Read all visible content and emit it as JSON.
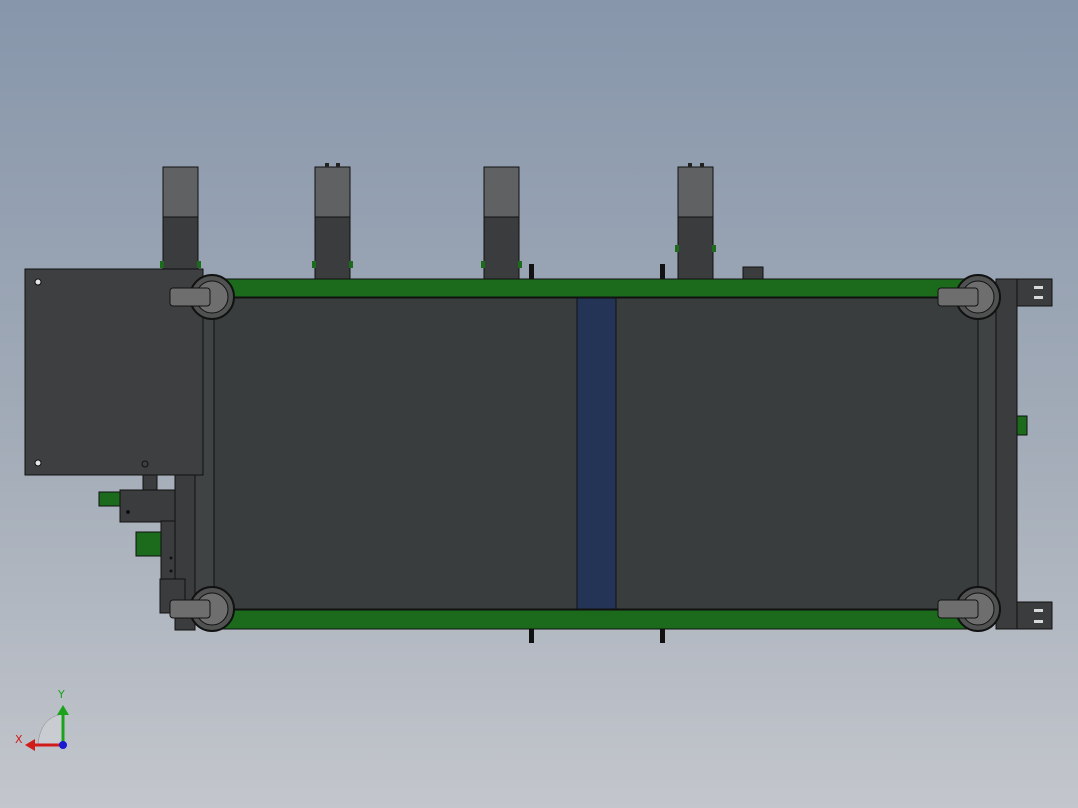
{
  "view": {
    "background_top": "#8796ab",
    "background_bottom": "#c3c6cc"
  },
  "model": {
    "frame_color": "#3a3d3d",
    "belt_rail_color": "#1c6b1c",
    "divider_color": "#233457",
    "panel_color": "#3d3f40",
    "sensor_top_color": "#5f6163",
    "caster_color": "#6e6e6e",
    "uprights_count": 4
  },
  "triad": {
    "x_label": "X",
    "y_label": "Y",
    "x_color": "#d11a1a",
    "y_color": "#1aa31a",
    "z_color": "#1a1ad1"
  }
}
